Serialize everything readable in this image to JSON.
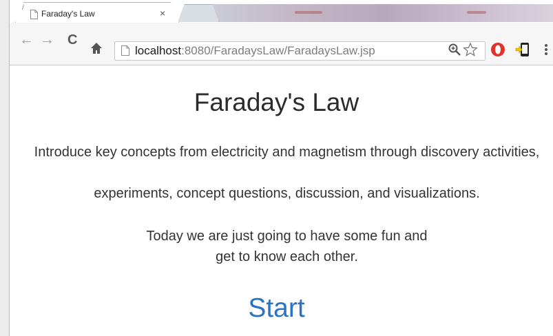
{
  "browser": {
    "tab": {
      "marker": "/",
      "title": "Faraday's Law",
      "close_glyph": "×",
      "favicon": "page-icon"
    },
    "toolbar": {
      "back_glyph": "←",
      "forward_glyph": "→",
      "reload_glyph": "C",
      "home_glyph": "🏠",
      "url_host": "localhost",
      "url_rest": ":8080/FaradaysLaw/FaradaysLaw.jsp",
      "icons": [
        "zoom-icon",
        "star-icon",
        "opera-icon",
        "extension-icon",
        "menu-icon"
      ]
    }
  },
  "page": {
    "title": "Faraday's Law",
    "intro_line1": "Introduce key concepts from electricity and magnetism through discovery activities,",
    "intro_line2": "experiments, concept questions, discussion, and visualizations.",
    "today_line1": "Today we are just going to have some fun and",
    "today_line2": "get to know each other.",
    "start_link": "Start"
  },
  "colors": {
    "link": "#2a73c4",
    "text": "#333333",
    "stop_icon": "#e0322b",
    "extension_icon": "#f2c200"
  }
}
